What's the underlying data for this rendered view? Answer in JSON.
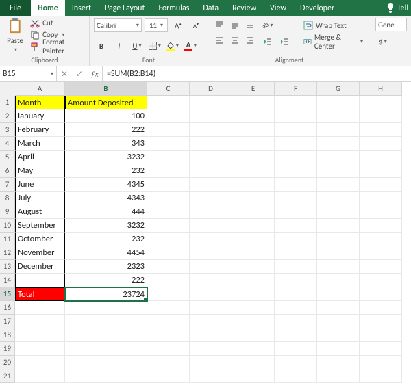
{
  "tabs": {
    "file": "File",
    "items": [
      "Home",
      "Insert",
      "Page Layout",
      "Formulas",
      "Data",
      "Review",
      "View",
      "Developer"
    ],
    "active": "Home",
    "tell": "Tell"
  },
  "ribbon": {
    "clipboard": {
      "paste": "Paste",
      "cut": "Cut",
      "copy": "Copy",
      "format_painter": "Format Painter",
      "label": "Clipboard"
    },
    "font": {
      "name": "Calibri",
      "size": "11",
      "label": "Font"
    },
    "alignment": {
      "wrap": "Wrap Text",
      "merge": "Merge & Center",
      "label": "Alignment"
    },
    "number": {
      "format": "Gene",
      "currency": "$"
    }
  },
  "formula_bar": {
    "name_box": "B15",
    "formula": "=SUM(B2:B14)"
  },
  "columns": [
    "A",
    "B",
    "C",
    "D",
    "E",
    "F",
    "G",
    "H"
  ],
  "selected_row": 15,
  "selected_col": "B",
  "chart_data": {
    "type": "table",
    "headers": [
      "Month",
      "Amount Deposited"
    ],
    "rows": [
      [
        "Ianuary",
        100
      ],
      [
        "February",
        222
      ],
      [
        "March",
        343
      ],
      [
        "April",
        3232
      ],
      [
        "May",
        232
      ],
      [
        "June",
        4345
      ],
      [
        "July",
        4343
      ],
      [
        "August",
        444
      ],
      [
        "September",
        3232
      ],
      [
        "Octomber",
        232
      ],
      [
        "November",
        4454
      ],
      [
        "December",
        2323
      ],
      [
        "",
        222
      ]
    ],
    "total_label": "Total",
    "total_value": 23724
  }
}
